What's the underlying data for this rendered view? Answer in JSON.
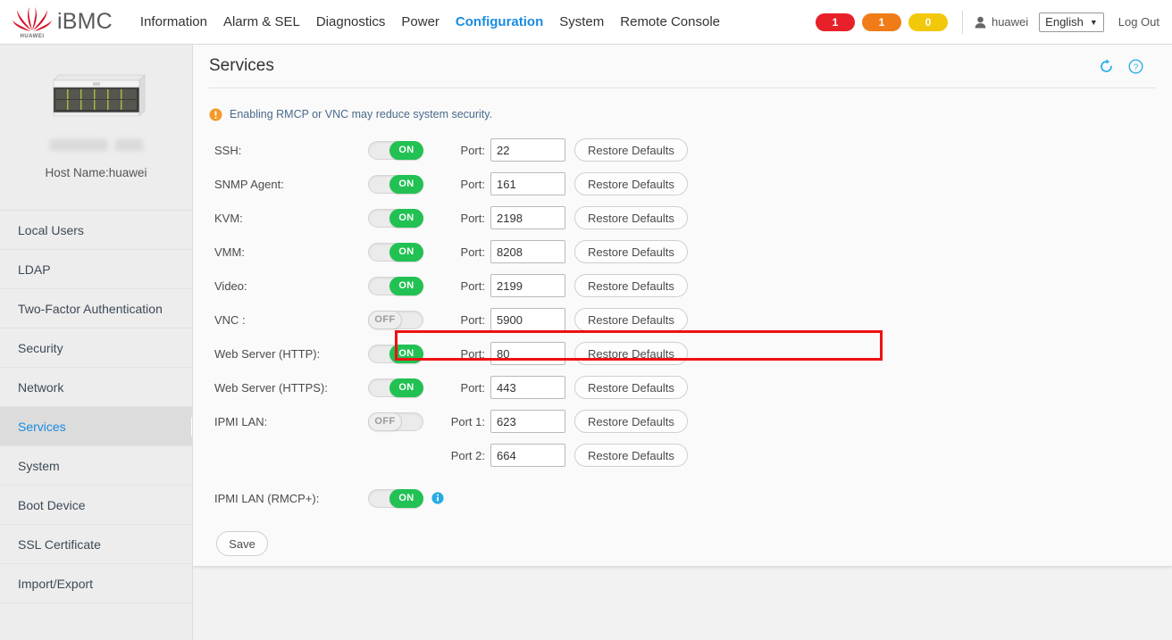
{
  "header": {
    "brand": "iBMC",
    "brand_logo_word": "HUAWEI",
    "nav": [
      {
        "label": "Information",
        "active": false
      },
      {
        "label": "Alarm & SEL",
        "active": false
      },
      {
        "label": "Diagnostics",
        "active": false
      },
      {
        "label": "Power",
        "active": false
      },
      {
        "label": "Configuration",
        "active": true
      },
      {
        "label": "System",
        "active": false
      },
      {
        "label": "Remote Console",
        "active": false
      }
    ],
    "badges": [
      {
        "name": "critical-alarm-badge",
        "value": "1",
        "color": "#e8202a"
      },
      {
        "name": "major-alarm-badge",
        "value": "1",
        "color": "#f07c18"
      },
      {
        "name": "minor-alarm-badge",
        "value": "0",
        "color": "#f2c80a"
      }
    ],
    "user": "huawei",
    "language": "English",
    "logout": "Log Out"
  },
  "sidebar": {
    "hostname": "Host Name:huawei",
    "items": [
      {
        "label": "Local Users",
        "active": false
      },
      {
        "label": "LDAP",
        "active": false
      },
      {
        "label": "Two-Factor Authentication",
        "active": false
      },
      {
        "label": "Security",
        "active": false
      },
      {
        "label": "Network",
        "active": false
      },
      {
        "label": "Services",
        "active": true
      },
      {
        "label": "System",
        "active": false
      },
      {
        "label": "Boot Device",
        "active": false
      },
      {
        "label": "SSL Certificate",
        "active": false
      },
      {
        "label": "Import/Export",
        "active": false
      }
    ]
  },
  "page": {
    "title": "Services",
    "notice": "Enabling RMCP or VNC may reduce system security.",
    "port_label": "Port:",
    "port1_label": "Port 1:",
    "port2_label": "Port 2:",
    "restore_label": "Restore Defaults",
    "save_label": "Save",
    "toggle_on_text": "ON",
    "toggle_off_text": "OFF",
    "services": [
      {
        "name": "SSH:",
        "state": "ON",
        "port_label": "Port:",
        "port": "22",
        "restore": "Restore Defaults",
        "highlighted": false,
        "info": false
      },
      {
        "name": "SNMP Agent:",
        "state": "ON",
        "port_label": "Port:",
        "port": "161",
        "restore": "Restore Defaults",
        "highlighted": false,
        "info": false
      },
      {
        "name": "KVM:",
        "state": "ON",
        "port_label": "Port:",
        "port": "2198",
        "restore": "Restore Defaults",
        "highlighted": false,
        "info": false
      },
      {
        "name": "VMM:",
        "state": "ON",
        "port_label": "Port:",
        "port": "8208",
        "restore": "Restore Defaults",
        "highlighted": false,
        "info": false
      },
      {
        "name": "Video:",
        "state": "ON",
        "port_label": "Port:",
        "port": "2199",
        "restore": "Restore Defaults",
        "highlighted": true,
        "info": false
      },
      {
        "name": "VNC :",
        "state": "OFF",
        "port_label": "Port:",
        "port": "5900",
        "restore": "Restore Defaults",
        "highlighted": false,
        "info": false
      },
      {
        "name": "Web Server (HTTP):",
        "state": "ON",
        "port_label": "Port:",
        "port": "80",
        "restore": "Restore Defaults",
        "highlighted": false,
        "info": false
      },
      {
        "name": "Web Server (HTTPS):",
        "state": "ON",
        "port_label": "Port:",
        "port": "443",
        "restore": "Restore Defaults",
        "highlighted": false,
        "info": false
      },
      {
        "name": "IPMI LAN:",
        "state": "OFF",
        "port_label": "Port 1:",
        "port": "623",
        "restore": "Restore Defaults",
        "highlighted": false,
        "info": false
      }
    ],
    "ipmi_port2": {
      "port_label": "Port 2:",
      "port": "664",
      "restore": "Restore Defaults"
    },
    "rmcp": {
      "name": "IPMI LAN (RMCP+):",
      "state": "ON",
      "info": true
    }
  },
  "icons": {
    "refresh": "refresh-icon",
    "help": "help-icon",
    "warning": "warning-icon",
    "info": "info-icon",
    "user": "user-icon",
    "caret": "▼"
  },
  "colors": {
    "accent": "#1a8ce0",
    "toggle_on": "#22c153",
    "warning": "#f49a2b",
    "highlight": "#ee1111"
  }
}
